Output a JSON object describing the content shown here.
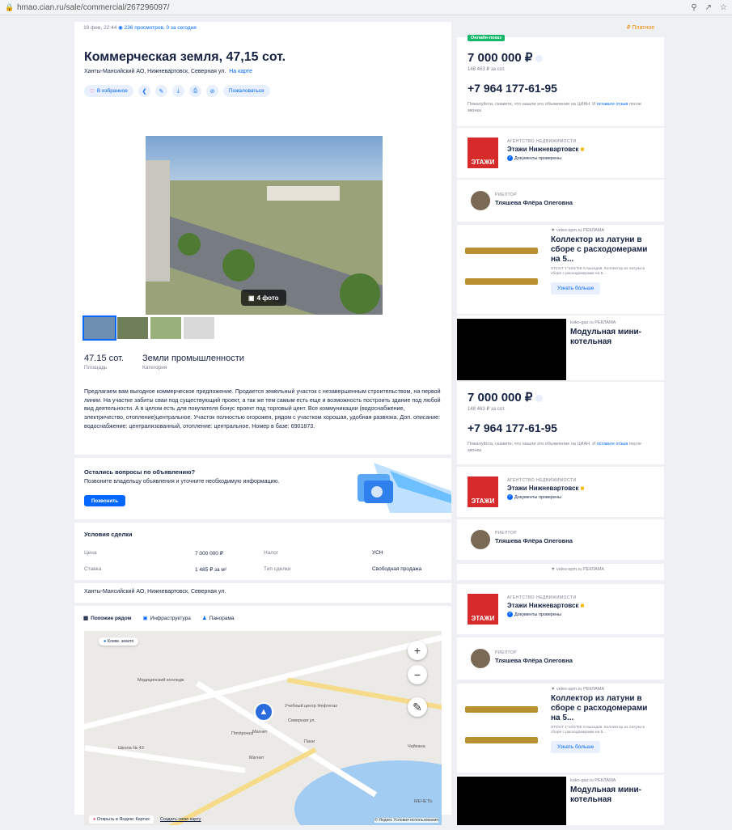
{
  "browser": {
    "url": "hmao.cian.ru/sale/commercial/267296097/"
  },
  "meta": {
    "date": "19 фев, 22:44",
    "views": "236 просмотров, 0 за сегодня",
    "paid": "₽ Платное"
  },
  "listing": {
    "title": "Коммерческая земля, 47,15 сот.",
    "address": "Ханты-Мансийский АО, Нижневартовск, Северная ул.",
    "map_link": "На карте",
    "favorite_label": "В избранное",
    "complain_label": "Пожаловаться",
    "photo_badge": "4 фото",
    "area_value": "47.15 сот.",
    "area_label": "Площадь",
    "category_value": "Земли промышленности",
    "category_label": "Категория",
    "description": "Предлагаем вам выгодное коммерческое предложение. Продается земельный участок с незавершенным строительством, на первой линии. На участке забиты сваи под существующий проект, а так же тем самым есть еще и возможность построить здание под любой вид деятельности. А в целом есть для покупателя бонус проект под торговый цент. Все коммуникации (водоснабжение, электричество, отопление)центральное. Участок полностью огорожен, рядом с участком хорошая, удобная развязка. Доп. описание: водоснабжение: централизованный, отопление: центральное. Номер в базе: 6901873."
  },
  "question": {
    "title": "Остались вопросы по объявлению?",
    "text": "Позвоните владельцу объявления и уточните необходимую информацию.",
    "button": "Позвонить"
  },
  "deal": {
    "title": "Условия сделки",
    "price_label": "Цена",
    "price_value": "7 000 000 ₽",
    "tax_label": "Налог",
    "tax_value": "УСН",
    "rate_label": "Ставка",
    "rate_value": "1 485 ₽ за м²",
    "type_label": "Тип сделки",
    "type_value": "Свободная продажа"
  },
  "map": {
    "address": "Ханты-Мансийский АО, Нижневартовск, Северная ул.",
    "tabs": [
      "Похожие рядом",
      "Инфраструктура",
      "Панорама"
    ],
    "chip": "Комм. земля",
    "open_label": "Открыть в Яндекс Картах",
    "create_label": "Создать свою карту",
    "copyright": "© Яндекс Условия использования",
    "labels": [
      "Медицинский колледж",
      "Учебный центр Нефтегаз",
      "Северная ул.",
      "Школа № 43",
      "Магнит",
      "Пятёрочка",
      "Магнит",
      "Пани",
      "Чайхана",
      "МЕЧЕТЬ"
    ]
  },
  "sidebar": {
    "online_label": "Онлайн-показ",
    "price": "7 000 000 ₽",
    "price_per_m": "148 463 ₽ за сот.",
    "phone": "+7 964 177-61-95",
    "hint": "Пожалуйста, скажите, что нашли это объявление на ЦИАН. И",
    "hint_link": "оставьте отзыв",
    "hint_tail": "после звонка",
    "agency_label": "АГЕНТСТВО НЕДВИЖИМОСТИ",
    "agency_name": "Этажи Нижневартовск",
    "agency_docs": "Документы проверены",
    "agency_logo": "ЭТАЖИ",
    "realtor_label": "РИЕЛТОР",
    "realtor_name": "Тляшева Флёра Олеговна"
  },
  "ads": {
    "veles_src": "veles-spm.ru",
    "ad_label": "РЕКЛАМА",
    "veles_title": "Коллектор из латуни в сборе с расходомерами на 5...",
    "veles_sub": "STOUT 1\"x3/4\"EK 5 выходов. Коллектор из латуни в сборе с расходомерами на 5...",
    "veles_btn": "Узнать больше",
    "koko_src": "koko-gaz.ru",
    "koko_title": "Модульная мини-котельная"
  }
}
